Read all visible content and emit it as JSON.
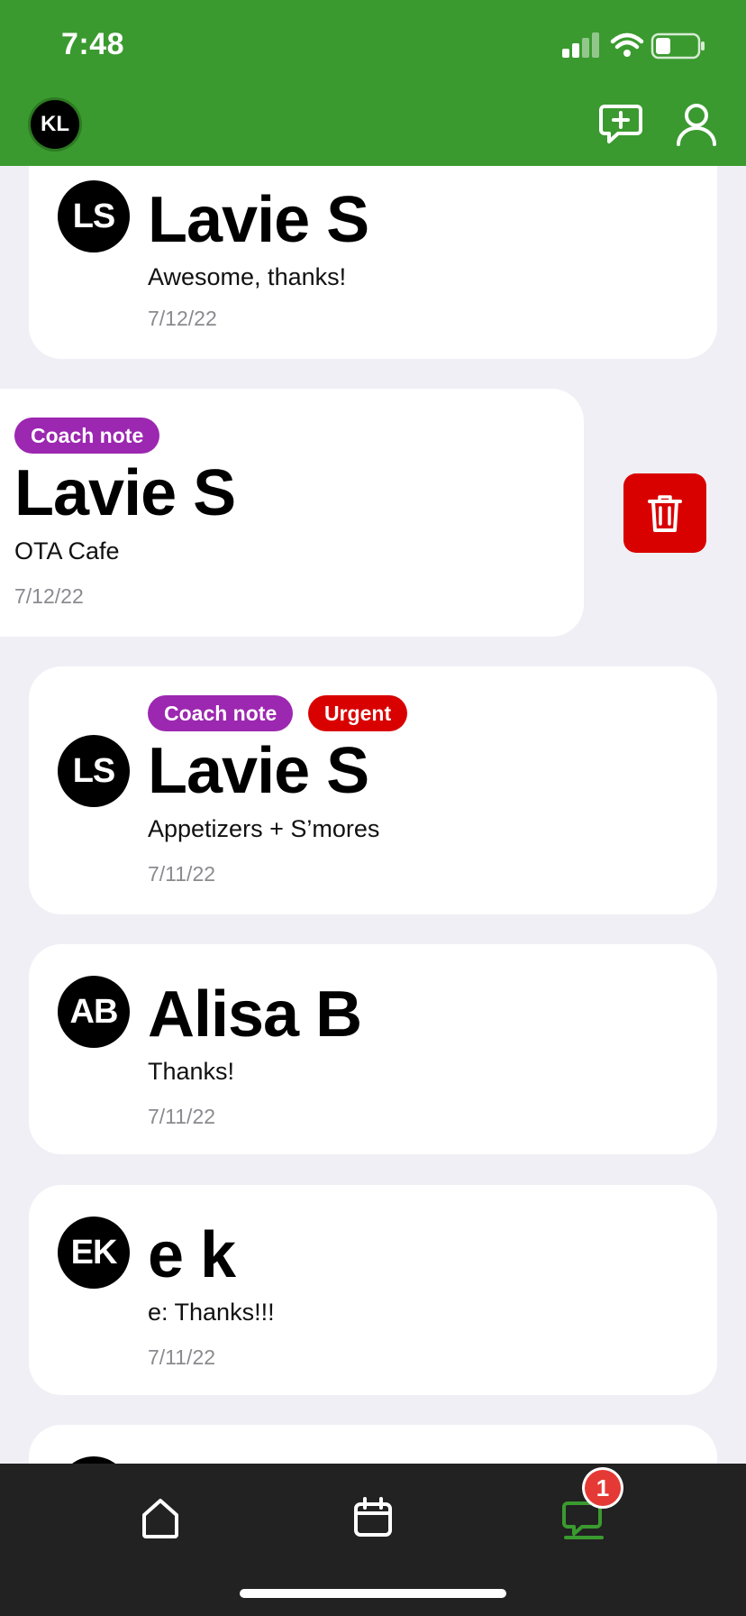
{
  "status_bar": {
    "time": "7:48"
  },
  "header": {
    "profile_initials": "KL"
  },
  "threads": [
    {
      "initials": "LS",
      "name": "Lavie S",
      "preview": "Awesome, thanks!",
      "date": "7/12/22",
      "badges": []
    },
    {
      "initials": "",
      "name": "Lavie S",
      "preview": "OTA Cafe",
      "date": "7/12/22",
      "badges": [
        "Coach note"
      ]
    },
    {
      "initials": "LS",
      "name": "Lavie S",
      "preview": "Appetizers + S’mores",
      "date": "7/11/22",
      "badges": [
        "Coach note",
        "Urgent"
      ]
    },
    {
      "initials": "AB",
      "name": "Alisa B",
      "preview": "Thanks!",
      "date": "7/11/22",
      "badges": []
    },
    {
      "initials": "EK",
      "name": "e k",
      "preview": "e: Thanks!!!",
      "date": "7/11/22",
      "badges": []
    }
  ],
  "bottom_nav": {
    "messages_badge": "1"
  },
  "icons": {
    "new_message": "chat-plus-icon",
    "account": "person-icon",
    "delete": "trash-icon",
    "home": "home-icon",
    "calendar": "calendar-icon",
    "messages": "chat-bubble-icon"
  },
  "colors": {
    "brand_green": "#3a9a2f",
    "coach_note": "#9c27b0",
    "urgent": "#d90000"
  }
}
